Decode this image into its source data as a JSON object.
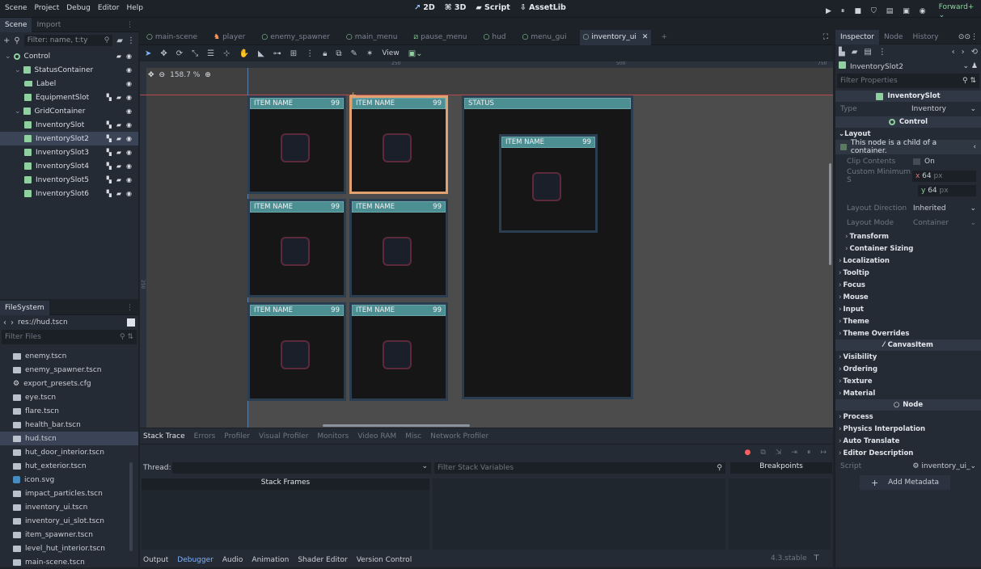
{
  "menu": [
    "Scene",
    "Project",
    "Debug",
    "Editor",
    "Help"
  ],
  "modes": [
    "2D",
    "3D",
    "Script",
    "AssetLib"
  ],
  "renderer": "Forward+",
  "scene_dock": {
    "tabs": [
      "Scene",
      "Import"
    ],
    "filter_placeholder": "Filter: name, t:ty",
    "tree": [
      {
        "name": "Control",
        "depth": 0,
        "type": "control",
        "icons": "script-vis"
      },
      {
        "name": "StatusContainer",
        "depth": 1,
        "type": "container",
        "icons": "vis"
      },
      {
        "name": "Label",
        "depth": 2,
        "type": "label",
        "icons": "vis"
      },
      {
        "name": "EquipmentSlot",
        "depth": 2,
        "type": "node",
        "icons": "full"
      },
      {
        "name": "GridContainer",
        "depth": 1,
        "type": "grid",
        "icons": "vis"
      },
      {
        "name": "InventorySlot",
        "depth": 2,
        "type": "node",
        "icons": "full"
      },
      {
        "name": "InventorySlot2",
        "depth": 2,
        "type": "node",
        "icons": "full",
        "selected": true
      },
      {
        "name": "InventorySlot3",
        "depth": 2,
        "type": "node",
        "icons": "full"
      },
      {
        "name": "InventorySlot4",
        "depth": 2,
        "type": "node",
        "icons": "full"
      },
      {
        "name": "InventorySlot5",
        "depth": 2,
        "type": "node",
        "icons": "full"
      },
      {
        "name": "InventorySlot6",
        "depth": 2,
        "type": "node",
        "icons": "full"
      }
    ]
  },
  "filesystem": {
    "title": "FileSystem",
    "path": "res://hud.tscn",
    "filter_placeholder": "Filter Files",
    "files": [
      {
        "name": "enemy.tscn",
        "kind": "scene"
      },
      {
        "name": "enemy_spawner.tscn",
        "kind": "scene"
      },
      {
        "name": "export_presets.cfg",
        "kind": "cfg"
      },
      {
        "name": "eye.tscn",
        "kind": "scene"
      },
      {
        "name": "flare.tscn",
        "kind": "scene"
      },
      {
        "name": "health_bar.tscn",
        "kind": "scene"
      },
      {
        "name": "hud.tscn",
        "kind": "scene",
        "selected": true
      },
      {
        "name": "hut_door_interior.tscn",
        "kind": "scene"
      },
      {
        "name": "hut_exterior.tscn",
        "kind": "scene"
      },
      {
        "name": "icon.svg",
        "kind": "svg"
      },
      {
        "name": "impact_particles.tscn",
        "kind": "scene"
      },
      {
        "name": "inventory_ui.tscn",
        "kind": "scene"
      },
      {
        "name": "inventory_ui_slot.tscn",
        "kind": "scene"
      },
      {
        "name": "item_spawner.tscn",
        "kind": "scene"
      },
      {
        "name": "level_hut_interior.tscn",
        "kind": "scene"
      },
      {
        "name": "main-scene.tscn",
        "kind": "scene"
      }
    ]
  },
  "editor_tabs": [
    {
      "name": "main-scene",
      "active": false
    },
    {
      "name": "player",
      "active": false
    },
    {
      "name": "enemy_spawner",
      "active": false
    },
    {
      "name": "main_menu",
      "active": false
    },
    {
      "name": "pause_menu",
      "active": false
    },
    {
      "name": "hud",
      "active": false
    },
    {
      "name": "menu_gui",
      "active": false
    },
    {
      "name": "inventory_ui",
      "active": true
    }
  ],
  "toolbar": {
    "view_label": "View",
    "zoom": "158.7 %"
  },
  "ruler": {
    "mark_250": "250",
    "mark_500": "500",
    "mark_750": "750",
    "mark_v250": "250"
  },
  "canvas": {
    "slot_title": "ITEM NAME",
    "slot_count": "99",
    "status_title": "STATUS"
  },
  "bottom": {
    "tabs": [
      "Stack Trace",
      "Errors",
      "Profiler",
      "Visual Profiler",
      "Monitors",
      "Video RAM",
      "Misc",
      "Network Profiler"
    ],
    "thread_label": "Thread:",
    "filter_stack": "Filter Stack Variables",
    "breakpoints": "Breakpoints",
    "stack_frames": "Stack Frames",
    "panel_tabs": [
      "Output",
      "Debugger",
      "Audio",
      "Animation",
      "Shader Editor",
      "Version Control"
    ],
    "version": "4.3.stable"
  },
  "inspector": {
    "tabs": [
      "Inspector",
      "Node",
      "History"
    ],
    "node_name": "InventorySlot2",
    "filter_placeholder": "Filter Properties",
    "class_header": "InventorySlot",
    "type_label": "Type",
    "type_value": "Inventory",
    "control_header": "Control",
    "layout_section": "Layout",
    "child_note": "This node is a child of a container.",
    "clip_label": "Clip Contents",
    "clip_value": "On",
    "min_size_label": "Custom Minimum S",
    "min_x_label": "x",
    "min_x": "64",
    "min_y_label": "y",
    "min_y": "64",
    "px_unit": "px",
    "layout_dir_label": "Layout Direction",
    "layout_dir_value": "Inherited",
    "layout_mode_label": "Layout Mode",
    "layout_mode_value": "Container",
    "sub_sections": [
      "Transform",
      "Container Sizing"
    ],
    "control_sections": [
      "Localization",
      "Tooltip",
      "Focus",
      "Mouse",
      "Input",
      "Theme",
      "Theme Overrides"
    ],
    "canvas_header": "CanvasItem",
    "canvas_sections": [
      "Visibility",
      "Ordering",
      "Texture",
      "Material"
    ],
    "node_header": "Node",
    "node_sections": [
      "Process",
      "Physics Interpolation",
      "Auto Translate",
      "Editor Description"
    ],
    "script_label": "Script",
    "script_value": "inventory_ui_",
    "add_metadata": "Add Metadata"
  },
  "colors": {
    "accent": "#4c8f93",
    "slot_border": "#2b3d50",
    "selection": "#e0a070"
  }
}
